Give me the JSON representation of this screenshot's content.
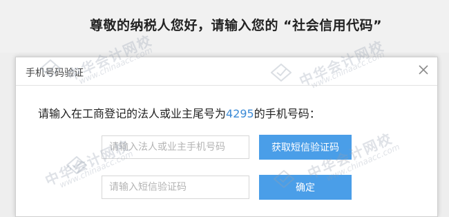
{
  "page": {
    "prompt": "尊敬的纳税人您好，请输入您的 “社会信用代码”"
  },
  "dialog": {
    "title": "手机号码验证",
    "close_symbol": "✕",
    "instruction_before": "请输入在工商登记的法人或业主尾号为",
    "phone_tail": "4295",
    "instruction_after": "的手机号码：",
    "phone_placeholder": "请输入法人或业主手机号码",
    "sms_button_label": "获取短信验证码",
    "code_placeholder": "请输入短信验证码",
    "confirm_button_label": "确定"
  },
  "watermark": {
    "text": "中华会计网校",
    "url": "www.chinaacc.com"
  },
  "colors": {
    "accent_blue": "#4a9ee8",
    "digits_blue": "#3b8ad6"
  }
}
